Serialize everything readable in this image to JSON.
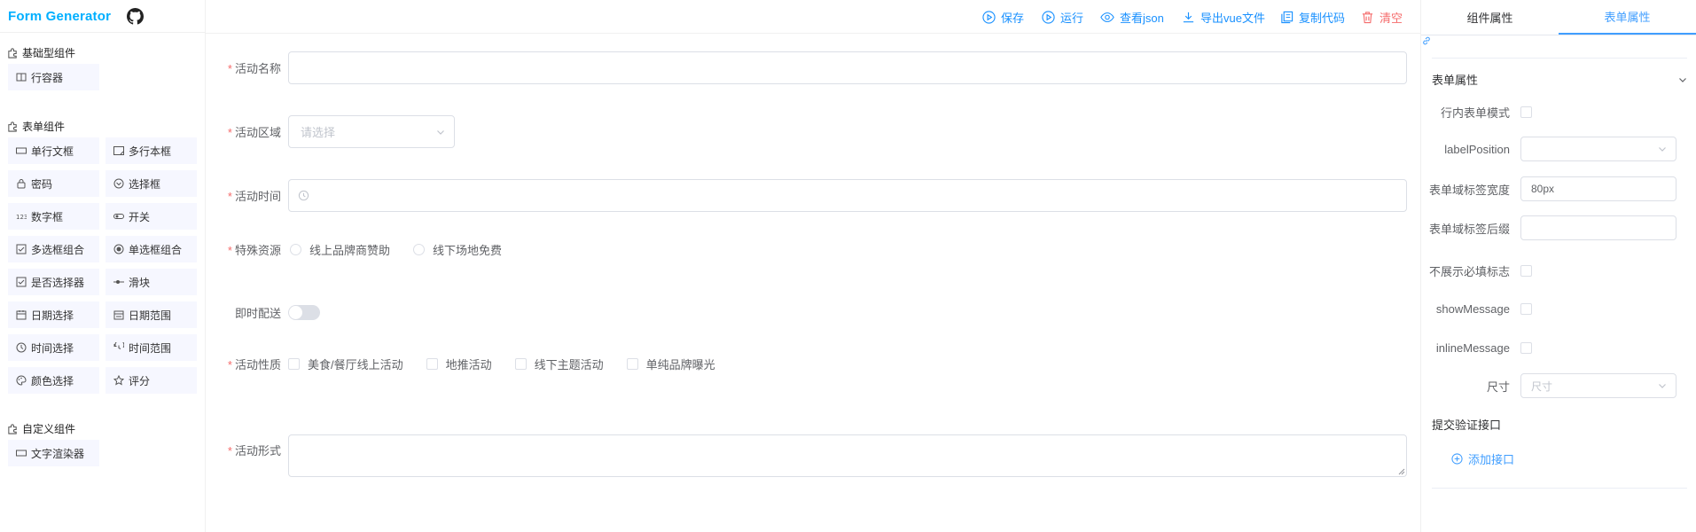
{
  "app": {
    "title": "Form Generator"
  },
  "left_panel": {
    "groups": [
      {
        "title": "基础型组件",
        "items": [
          {
            "label": "行容器",
            "icon": "row-icon"
          }
        ]
      },
      {
        "title": "表单组件",
        "items": [
          {
            "label": "单行文框",
            "icon": "input-icon"
          },
          {
            "label": "多行本框",
            "icon": "textarea-icon"
          },
          {
            "label": "密码",
            "icon": "password-icon"
          },
          {
            "label": "选择框",
            "icon": "select-icon"
          },
          {
            "label": "数字框",
            "icon": "number-icon"
          },
          {
            "label": "开关",
            "icon": "switch-icon"
          },
          {
            "label": "多选框组合",
            "icon": "checkbox-icon"
          },
          {
            "label": "单选框组合",
            "icon": "radio-icon"
          },
          {
            "label": "是否选择器",
            "icon": "checkbox-icon"
          },
          {
            "label": "滑块",
            "icon": "slider-icon"
          },
          {
            "label": "日期选择",
            "icon": "date-icon"
          },
          {
            "label": "日期范围",
            "icon": "date-range-icon"
          },
          {
            "label": "时间选择",
            "icon": "time-icon"
          },
          {
            "label": "时间范围",
            "icon": "time-range-icon"
          },
          {
            "label": "颜色选择",
            "icon": "color-icon"
          },
          {
            "label": "评分",
            "icon": "star-icon"
          }
        ]
      },
      {
        "title": "自定义组件",
        "items": [
          {
            "label": "文字渲染器",
            "icon": "input-icon"
          }
        ]
      }
    ]
  },
  "toolbar": {
    "save": "保存",
    "run": "运行",
    "view_json": "查看json",
    "export_vue": "导出vue文件",
    "copy_code": "复制代码",
    "clear": "清空"
  },
  "form": {
    "activity_name": {
      "label": "活动名称",
      "value": ""
    },
    "activity_region": {
      "label": "活动区域",
      "placeholder": "请选择"
    },
    "activity_time": {
      "label": "活动时间",
      "value": ""
    },
    "special_resource": {
      "label": "特殊资源",
      "options": [
        "线上品牌商赞助",
        "线下场地免费"
      ]
    },
    "instant_delivery": {
      "label": "即时配送",
      "checked": false
    },
    "activity_nature": {
      "label": "活动性质",
      "options": [
        "美食/餐厅线上活动",
        "地推活动",
        "线下主题活动",
        "单纯品牌曝光"
      ]
    },
    "activity_form": {
      "label": "活动形式",
      "value": ""
    }
  },
  "right_panel": {
    "tabs": [
      "组件属性",
      "表单属性"
    ],
    "active_tab": 1,
    "section_title": "表单属性",
    "props": {
      "inline": {
        "label": "行内表单模式",
        "checked": false
      },
      "label_position": {
        "label": "labelPosition",
        "value": ""
      },
      "label_width": {
        "label": "表单域标签宽度",
        "value": "80px"
      },
      "label_suffix": {
        "label": "表单域标签后缀",
        "value": ""
      },
      "hide_required": {
        "label": "不展示必填标志",
        "checked": false
      },
      "show_message": {
        "label": "showMessage",
        "checked": false
      },
      "inline_message": {
        "label": "inlineMessage",
        "checked": false
      },
      "size": {
        "label": "尺寸",
        "placeholder": "尺寸"
      }
    },
    "validate_api_title": "提交验证接口",
    "add_api": "添加接口"
  },
  "colors": {
    "brand": "#00afff",
    "primary": "#1890ff",
    "danger": "#f56c6c",
    "tab_active": "#409eff"
  }
}
